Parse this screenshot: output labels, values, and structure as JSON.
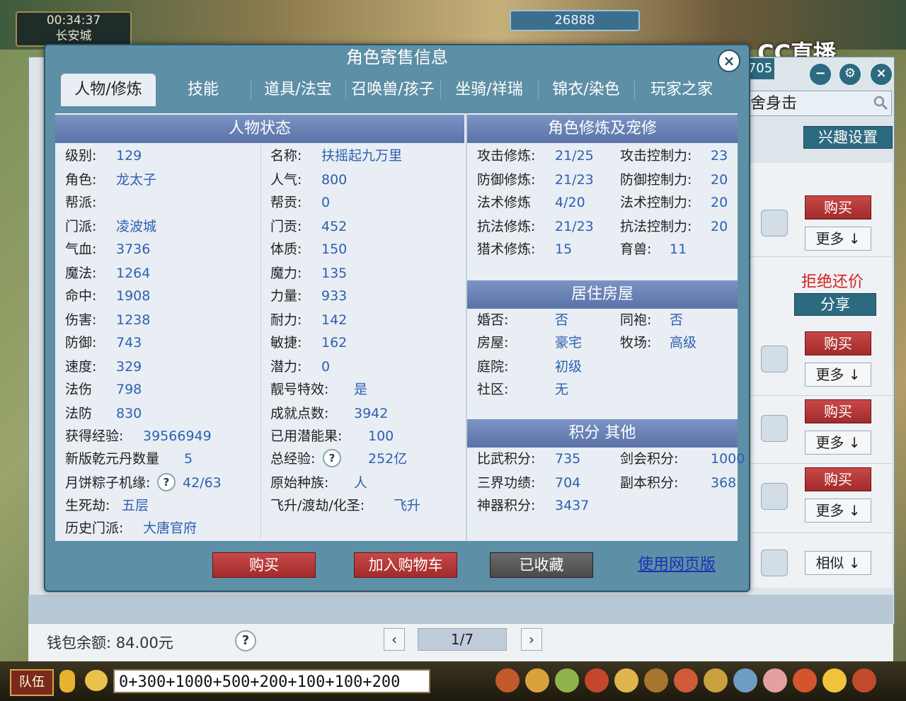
{
  "hud": {
    "time": "00:34:37",
    "location": "长安城",
    "money": "26888",
    "brand": "CC直播",
    "badge": "705"
  },
  "market": {
    "search_text": "舍身击",
    "interest_button": "兴趣设置",
    "refuse_bargain": "拒绝还价",
    "share_button": "分享",
    "buy_label": "购买",
    "more_label": "更多",
    "similar_label": "相似",
    "wallet": "钱包余额: 84.00元",
    "page": "1/7"
  },
  "dialog": {
    "title": "角色寄售信息",
    "tabs": [
      "人物/修炼",
      "技能",
      "道具/法宝",
      "召唤兽/孩子",
      "坐骑/祥瑞",
      "锦衣/染色",
      "玩家之家"
    ],
    "sections": {
      "status": "人物状态",
      "cultivation": "角色修炼及宠修",
      "housing": "居住房屋",
      "points": "积分 其他"
    },
    "status_left": [
      {
        "k": "级别:",
        "v": "129"
      },
      {
        "k": "角色:",
        "v": "龙太子"
      },
      {
        "k": "帮派:",
        "v": ""
      },
      {
        "k": "门派:",
        "v": "凌波城"
      },
      {
        "k": "气血:",
        "v": "3736"
      },
      {
        "k": "魔法:",
        "v": "1264"
      },
      {
        "k": "命中:",
        "v": "1908"
      },
      {
        "k": "伤害:",
        "v": "1238"
      },
      {
        "k": "防御:",
        "v": "743"
      },
      {
        "k": "速度:",
        "v": "329"
      },
      {
        "k": "法伤",
        "v": "798"
      },
      {
        "k": "法防",
        "v": "830"
      },
      {
        "k": "获得经验:",
        "v": "39566949"
      },
      {
        "k": "新版乾元丹数量",
        "v": "5"
      },
      {
        "k": "月饼粽子机缘:",
        "v": "42/63"
      },
      {
        "k": "生死劫:",
        "v": "五层"
      },
      {
        "k": "历史门派:",
        "v": "大唐官府"
      }
    ],
    "status_mid": [
      {
        "k": "名称:",
        "v": "扶摇起九万里"
      },
      {
        "k": "人气:",
        "v": "800"
      },
      {
        "k": "帮贡:",
        "v": "0"
      },
      {
        "k": "门贡:",
        "v": "452"
      },
      {
        "k": "体质:",
        "v": "150"
      },
      {
        "k": "魔力:",
        "v": "135"
      },
      {
        "k": "力量:",
        "v": "933"
      },
      {
        "k": "耐力:",
        "v": "142"
      },
      {
        "k": "敏捷:",
        "v": "162"
      },
      {
        "k": "潜力:",
        "v": "0"
      },
      {
        "k": "靓号特效:",
        "v": "是"
      },
      {
        "k": "成就点数:",
        "v": "3942"
      },
      {
        "k": "已用潜能果:",
        "v": "100"
      },
      {
        "k": "总经验:",
        "v": "252亿"
      },
      {
        "k": "原始种族:",
        "v": "人"
      },
      {
        "k": "飞升/渡劫/化圣:",
        "v": "飞升"
      }
    ],
    "cultivation": [
      {
        "k1": "攻击修炼:",
        "v1": "21/25",
        "k2": "攻击控制力:",
        "v2": "23"
      },
      {
        "k1": "防御修炼:",
        "v1": "21/23",
        "k2": "防御控制力:",
        "v2": "20"
      },
      {
        "k1": "法术修炼",
        "v1": "4/20",
        "k2": "法术控制力:",
        "v2": "20"
      },
      {
        "k1": "抗法修炼:",
        "v1": "21/23",
        "k2": "抗法控制力:",
        "v2": "20"
      },
      {
        "k1": "猎术修炼:",
        "v1": "15",
        "k2": "育兽:",
        "v2": "11"
      }
    ],
    "housing": [
      {
        "k1": "婚否:",
        "v1": "否",
        "k2": "同袍:",
        "v2": "否"
      },
      {
        "k1": "房屋:",
        "v1": "豪宅",
        "k2": "牧场:",
        "v2": "高级"
      },
      {
        "k1": "庭院:",
        "v1": "初级",
        "k2": "",
        "v2": ""
      },
      {
        "k1": "社区:",
        "v1": "无",
        "k2": "",
        "v2": ""
      }
    ],
    "points": [
      {
        "k1": "比武积分:",
        "v1": "735",
        "k2": "剑会积分:",
        "v2": "1000"
      },
      {
        "k1": "三界功绩:",
        "v1": "704",
        "k2": "副本积分:",
        "v2": "368"
      },
      {
        "k1": "神器积分:",
        "v1": "3437",
        "k2": "",
        "v2": ""
      }
    ],
    "buttons": {
      "buy": "购买",
      "add_cart": "加入购物车",
      "favorited": "已收藏",
      "web": "使用网页版"
    }
  },
  "chat": {
    "team": "队伍",
    "input": "0+300+1000+500+200+100+100+200"
  },
  "colors": {
    "dialog_bg": "#5d8fa6",
    "section_head": "#6a83b5",
    "value_blue": "#2f5fb0",
    "buy_red": "#b53535"
  }
}
